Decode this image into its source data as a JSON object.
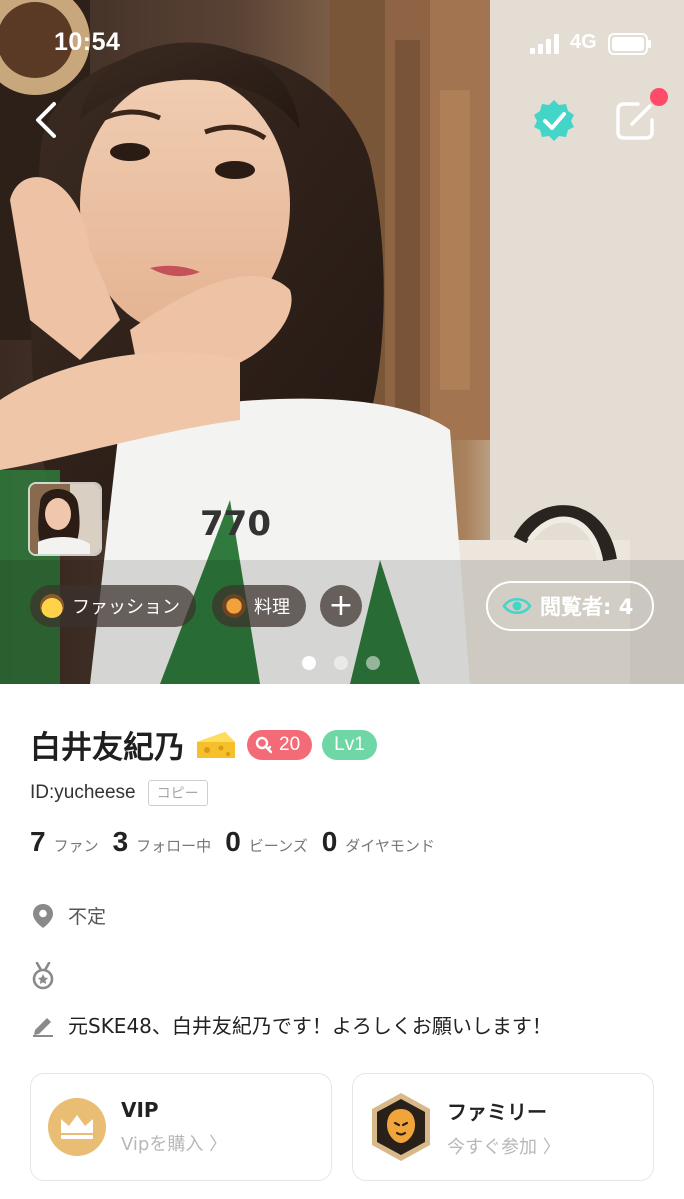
{
  "status_bar": {
    "time": "10:54",
    "network": "4G"
  },
  "nav": {
    "back_icon": "chevron-left-icon",
    "verify_icon": "verified-badge-icon",
    "edit_icon": "edit-icon"
  },
  "tags": [
    {
      "label": "ファッション",
      "icon": "cowboy-hat-emoji"
    },
    {
      "label": "料理",
      "icon": "cooking-emoji"
    }
  ],
  "add_tag_label": "+",
  "viewers": {
    "label": "閲覧者",
    "count": "4",
    "text": "閲覧者: 4"
  },
  "carousel": {
    "total": 3,
    "active": 1
  },
  "profile": {
    "name": "白井友紀乃",
    "name_emoji": "cheese",
    "fan_level": "20",
    "level": "Lv1",
    "id": "ID:yucheese",
    "copy_label": "コピー"
  },
  "stats": [
    {
      "value": "7",
      "label": "ファン"
    },
    {
      "value": "3",
      "label": "フォロー中"
    },
    {
      "value": "0",
      "label": "ビーンズ"
    },
    {
      "value": "0",
      "label": "ダイヤモンド"
    }
  ],
  "location": "不定",
  "bio": "元SKE48、白井友紀乃です！よろしくお願いします！",
  "cards": {
    "vip": {
      "title": "VIP",
      "sub": "Vipを購入 〉"
    },
    "family": {
      "title": "ファミリー",
      "sub": "今すぐ参加 〉"
    }
  },
  "colors": {
    "pink_badge": "#f26b77",
    "green_badge": "#6fd7a6",
    "verify": "#43d6c8",
    "notif_dot": "#ff4a6a",
    "vip_gold": "#e9bd73"
  }
}
